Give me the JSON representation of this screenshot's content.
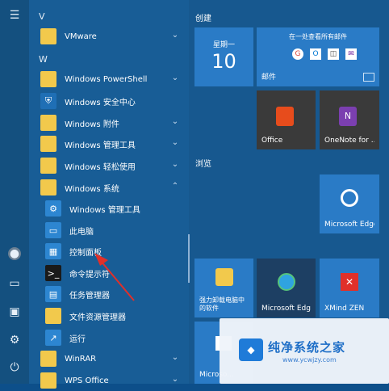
{
  "start_menu": {
    "rail_icons": [
      "hamburger-icon",
      "user-icon",
      "document-icon",
      "pictures-icon",
      "settings-icon",
      "power-icon"
    ],
    "app_list": {
      "headers": [
        "V",
        "W"
      ],
      "items": [
        {
          "label": "VMware",
          "icon": "folder"
        },
        {
          "label": "Windows PowerShell",
          "icon": "folder"
        },
        {
          "label": "Windows 安全中心",
          "icon": "shield"
        },
        {
          "label": "Windows 附件",
          "icon": "folder"
        },
        {
          "label": "Windows 管理工具",
          "icon": "folder"
        },
        {
          "label": "Windows 轻松使用",
          "icon": "folder"
        },
        {
          "label": "Windows 系统",
          "icon": "folder"
        },
        {
          "label": "Windows 管理工具",
          "icon": "admin-tools"
        },
        {
          "label": "此电脑",
          "icon": "computer"
        },
        {
          "label": "控制面板",
          "icon": "control-panel"
        },
        {
          "label": "命令提示符",
          "icon": "terminal"
        },
        {
          "label": "任务管理器",
          "icon": "task-manager"
        },
        {
          "label": "文件资源管理器",
          "icon": "folder"
        },
        {
          "label": "运行",
          "icon": "run"
        },
        {
          "label": "WinRAR",
          "icon": "folder"
        },
        {
          "label": "WPS Office",
          "icon": "folder"
        }
      ]
    },
    "tiles": {
      "section_create": "创建",
      "section_browse": "浏览",
      "calendar": {
        "weekday": "星期一",
        "day": "10"
      },
      "mail": {
        "headline": "在一处查看所有邮件",
        "label": "邮件"
      },
      "office": "Office",
      "onenote": "OneNote for ...",
      "edge1": "Microsoft Edge",
      "uninstall": "强力卸载电脑中\n的软件",
      "edge2": "Microsoft Edge",
      "xmind": "XMind ZEN",
      "store": "Microso..."
    },
    "watermark": {
      "title": "纯净系统之家",
      "url": "www.ycwjzy.com"
    },
    "colors": {
      "bg": "#17588f",
      "tile": "#2a7bc6",
      "arrow": "#e0302a"
    }
  }
}
